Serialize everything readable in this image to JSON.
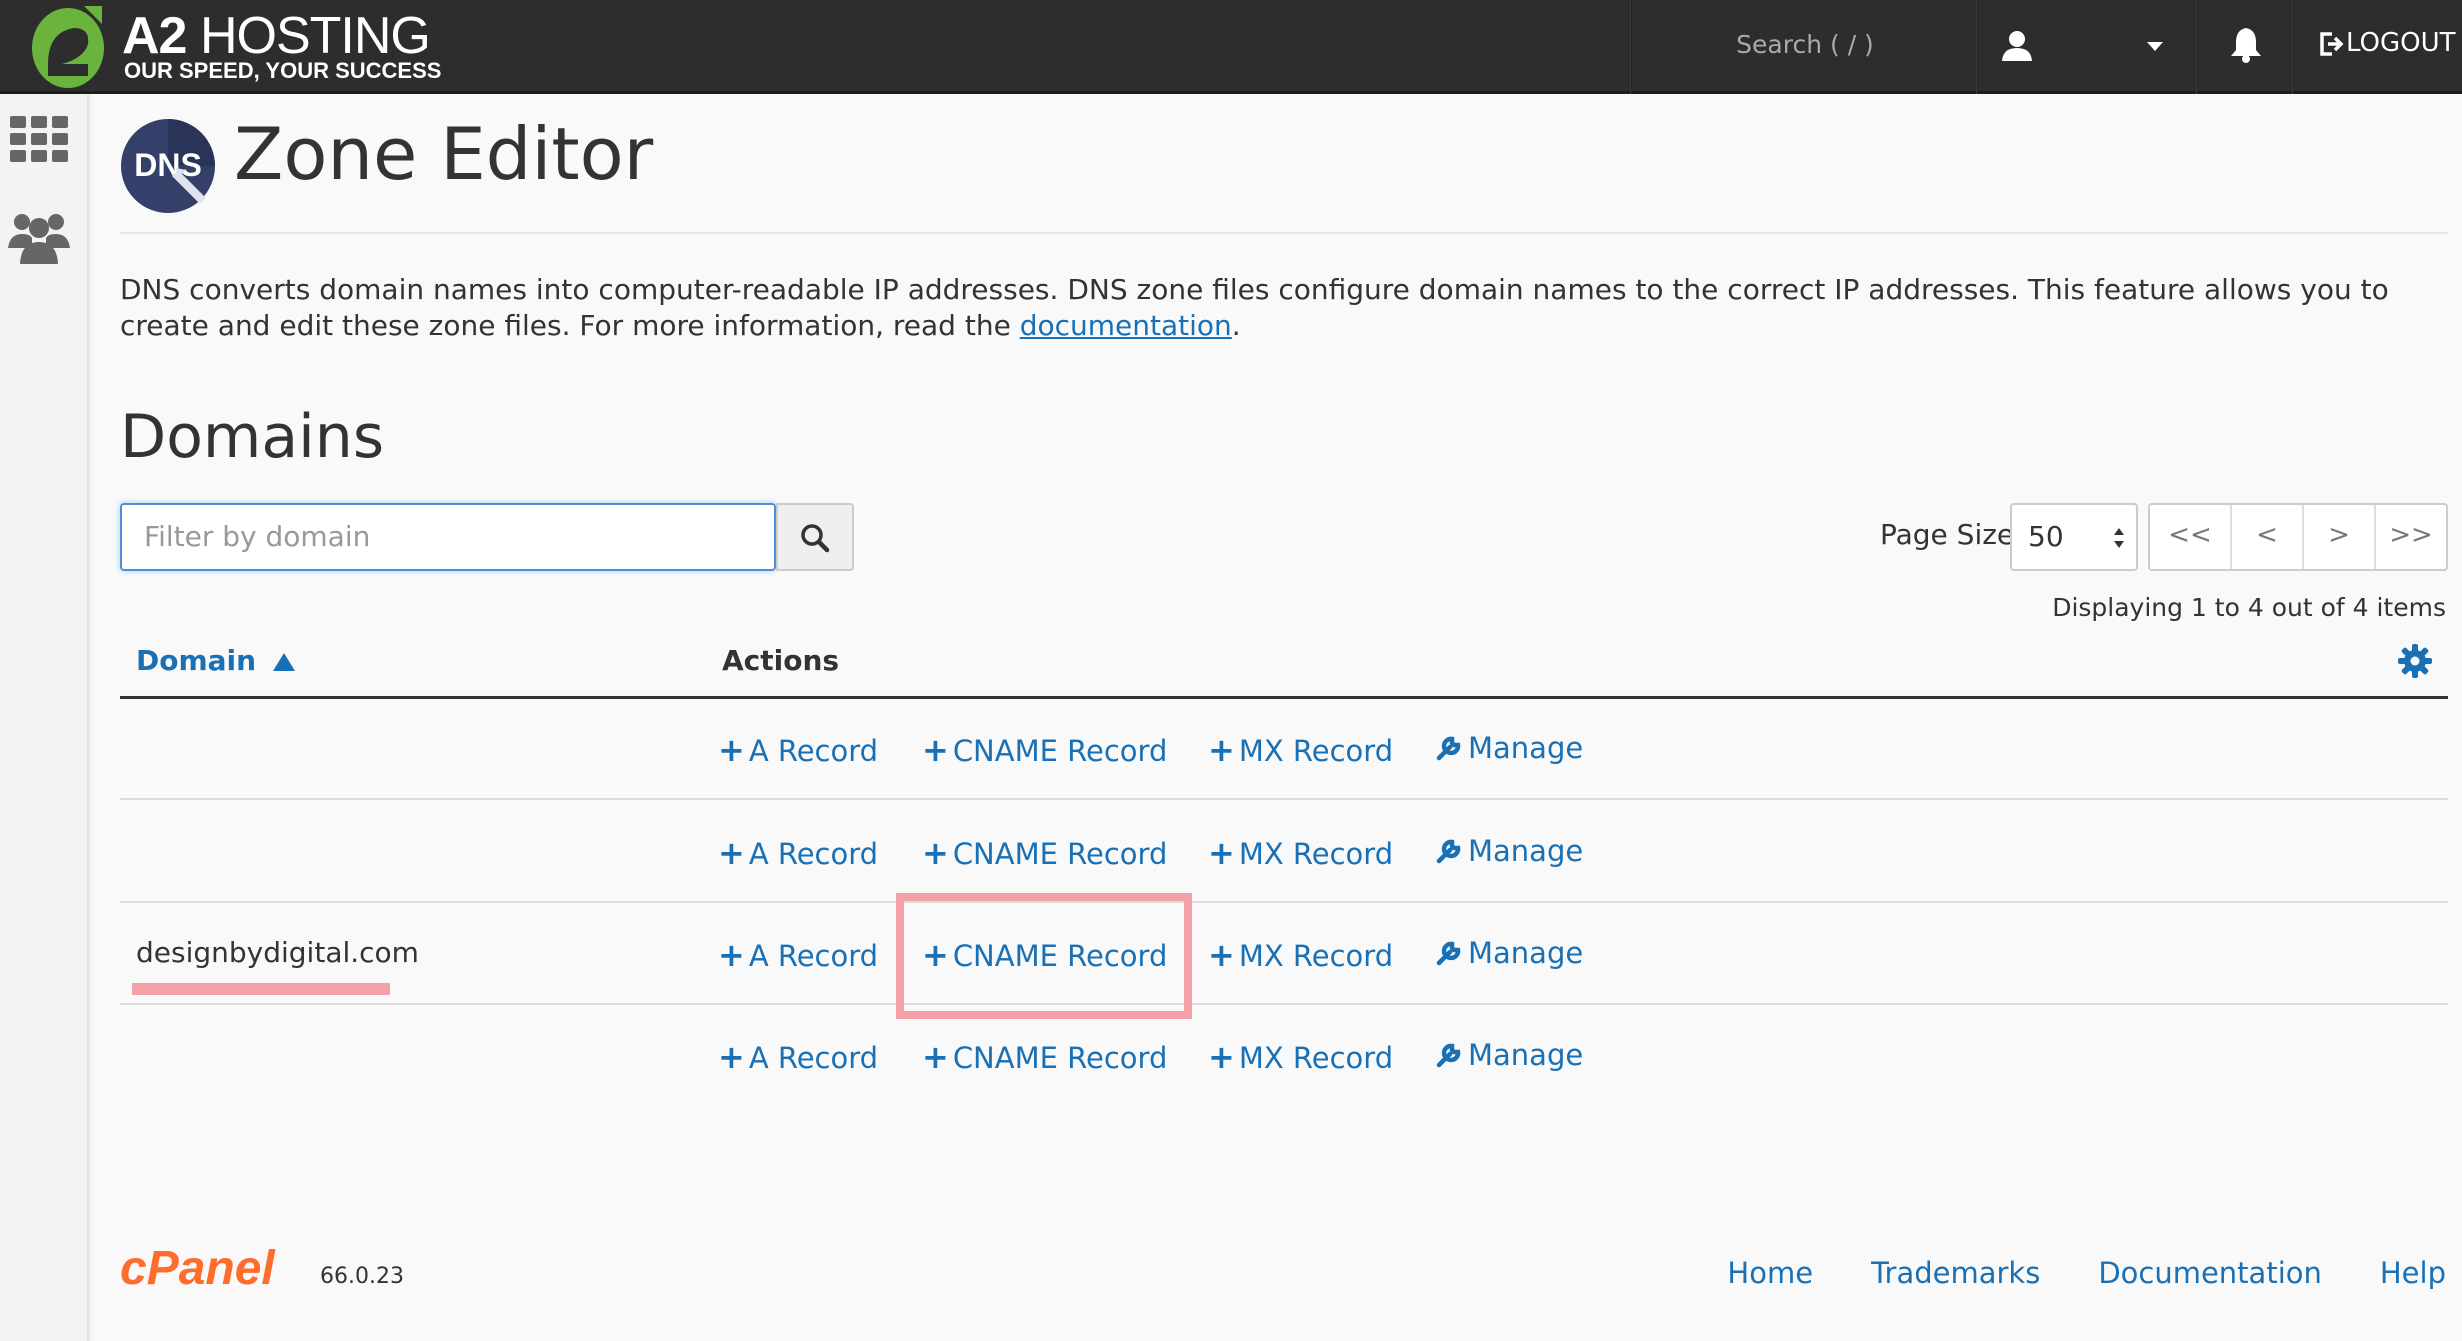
{
  "brand": {
    "name_a": "A2",
    "name_b": "HOSTING",
    "tagline": "OUR SPEED, YOUR SUCCESS"
  },
  "topbar": {
    "search_placeholder": "Search ( / )",
    "logout_label": "LOGOUT"
  },
  "page": {
    "dns_icon_text": "DNS",
    "title": "Zone Editor",
    "description": "DNS converts domain names into computer-readable IP addresses. DNS zone files configure domain names to the correct IP addresses. This feature allows you to create and edit these zone files. For more information, read the ",
    "description_link": "documentation",
    "description_end": "."
  },
  "domains": {
    "heading": "Domains",
    "filter_placeholder": "Filter by domain",
    "page_size_label": "Page Size",
    "page_size_value": "50",
    "pager": [
      "<<",
      "<",
      ">",
      ">>"
    ],
    "displaying": "Displaying 1 to 4 out of 4 items",
    "col_domain": "Domain",
    "col_actions": "Actions",
    "action_labels": {
      "a_record": "A Record",
      "cname_record": "CNAME Record",
      "mx_record": "MX Record",
      "manage": "Manage"
    },
    "rows": [
      {
        "domain": ""
      },
      {
        "domain": ""
      },
      {
        "domain": "designbydigital.com"
      },
      {
        "domain": ""
      }
    ]
  },
  "footer": {
    "cpanel_logo": "cPanel",
    "version": "66.0.23",
    "links": [
      "Home",
      "Trademarks",
      "Documentation",
      "Help"
    ]
  },
  "colors": {
    "topbar": "#2d2d2d",
    "link": "#1a70b5",
    "highlight": "#f4a0a8",
    "cpanel_orange": "#ff6c2c",
    "a2_green": "#6ab43e"
  }
}
